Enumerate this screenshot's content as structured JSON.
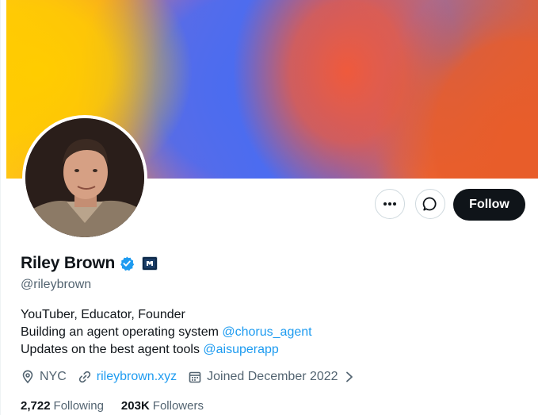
{
  "profile": {
    "display_name": "Riley Brown",
    "handle": "@rileybrown",
    "verified_badge": "verified-badge-icon",
    "affiliate_badge": "affiliate-badge-icon"
  },
  "actions": {
    "more_icon": "more-icon",
    "message_icon": "message-icon",
    "follow_label": "Follow"
  },
  "bio": {
    "line1": "YouTuber, Educator, Founder",
    "line2_text": "Building an agent operating system ",
    "line2_mention": "@chorus_agent",
    "line3_text": "Updates on the best agent tools ",
    "line3_mention": "@aisuperapp"
  },
  "meta": {
    "location": "NYC",
    "website": "rileybrown.xyz",
    "joined": "Joined December 2022"
  },
  "stats": {
    "following_count": "2,722",
    "following_label": "Following",
    "followers_count": "203K",
    "followers_label": "Followers"
  },
  "colors": {
    "accent": "#1d9bf0",
    "text_primary": "#0f1419",
    "text_secondary": "#536471",
    "button_dark": "#0f1419"
  }
}
